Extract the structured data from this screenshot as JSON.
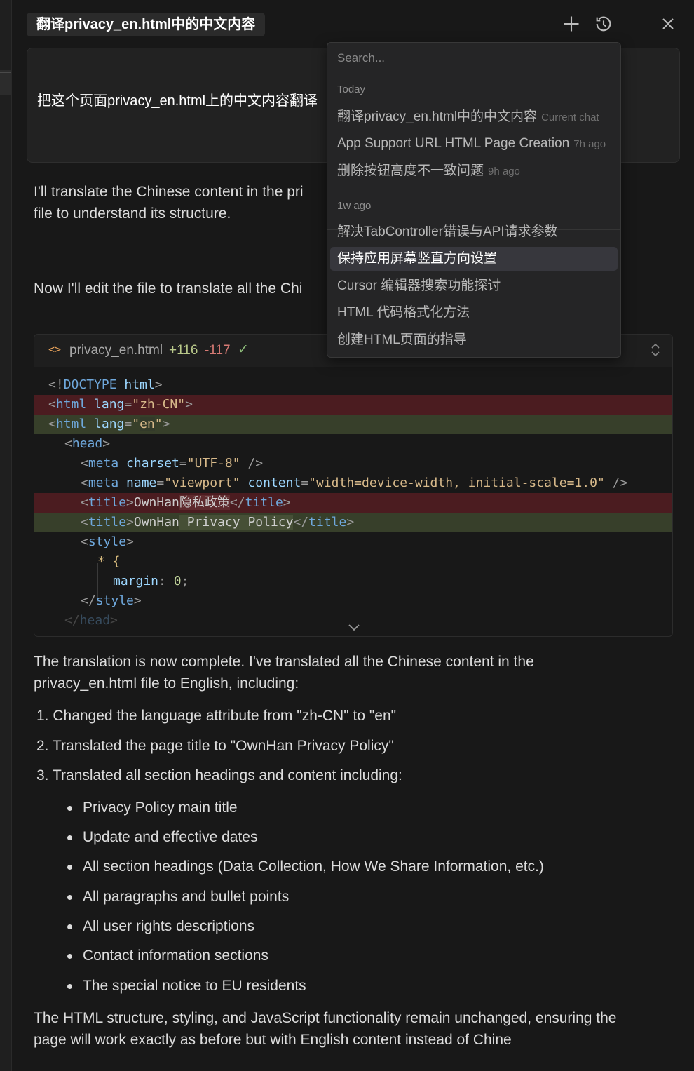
{
  "header": {
    "chat_title": "翻译privacy_en.html中的中文内容",
    "icons": [
      "plus-icon",
      "history-icon",
      "close-icon"
    ]
  },
  "user_message": "把这个页面privacy_en.html上的中文内容翻译",
  "assistant": {
    "intro_line1": "I'll translate the Chinese content in the pri",
    "intro_line2": "file to understand its structure.",
    "edit_line": "Now I'll edit the file to translate all the Chi",
    "summary_line1": "The translation is now complete. I've translated all the Chinese content in the",
    "summary_line2": "privacy_en.html file to English, including:",
    "numbered": [
      "1. Changed the language attribute from \"zh-CN\" to \"en\"",
      "2. Translated the page title to \"OwnHan Privacy Policy\"",
      "3. Translated all section headings and content including:"
    ],
    "bullets": [
      "Privacy Policy main title",
      "Update and effective dates",
      "All section headings (Data Collection, How We Share Information, etc.)",
      "All paragraphs and bullet points",
      "All user rights descriptions",
      "Contact information sections",
      "The special notice to EU residents"
    ],
    "closing_line1": "The HTML structure, styling, and JavaScript functionality remain unchanged, ensuring the",
    "closing_line2": "page will work exactly as before but with English content instead of Chine"
  },
  "code_block": {
    "file_icon": "<>",
    "filename": "privacy_en.html",
    "additions": "+116",
    "deletions": "-117",
    "check": "✓",
    "lines": {
      "l1_a": "<!",
      "l1_b": "DOCTYPE",
      "l1_c": " html",
      "l1_d": ">",
      "l2_a": "<",
      "l2_b": "html",
      "l2_c": " lang",
      "l2_d": "=",
      "l2_e": "\"zh-CN\"",
      "l2_f": ">",
      "l3_a": "<",
      "l3_b": "html",
      "l3_c": " lang",
      "l3_d": "=",
      "l3_e": "\"",
      "l3_f": "en",
      "l3_g": "\"",
      "l3_h": ">",
      "l4_a": "<",
      "l4_b": "head",
      "l4_c": ">",
      "l5_a": "<",
      "l5_b": "meta",
      "l5_c": " charset",
      "l5_d": "=",
      "l5_e": "\"UTF-8\"",
      "l5_f": " />",
      "l6_a": "<",
      "l6_b": "meta",
      "l6_c": " name",
      "l6_d": "=",
      "l6_e": "\"viewport\"",
      "l6_f": " content",
      "l6_g": "=",
      "l6_h": "\"width=device-width, initial-scale=1.0\"",
      "l6_i": " />",
      "l7_a": "<",
      "l7_b": "title",
      "l7_c": ">",
      "l7_d": "OwnHan",
      "l7_e": "隐私政策",
      "l7_f": "</",
      "l7_g": "title",
      "l7_h": ">",
      "l8_a": "<",
      "l8_b": "title",
      "l8_c": ">",
      "l8_d": "OwnHan",
      "l8_e": " Privacy Policy",
      "l8_f": "</",
      "l8_g": "title",
      "l8_h": ">",
      "l9_a": "<",
      "l9_b": "style",
      "l9_c": ">",
      "l10_a": "*",
      "l10_b": " {",
      "l11_a": "margin",
      "l11_b": ": ",
      "l11_c": "0",
      "l11_d": ";",
      "l12_a": "</",
      "l12_b": "style",
      "l12_c": ">",
      "l13_a": "</",
      "l13_b": "head",
      "l13_c": ">"
    }
  },
  "history_dropdown": {
    "search_placeholder": "Search...",
    "section_today": "Today",
    "section_week": "1w ago",
    "items_today": [
      {
        "label": "翻译privacy_en.html中的中文内容",
        "meta": "Current chat"
      },
      {
        "label": "App Support URL HTML Page Creation",
        "meta": "7h ago"
      },
      {
        "label": "删除按钮高度不一致问题",
        "meta": "9h ago"
      }
    ],
    "items_week": [
      {
        "label": "解决TabController错误与API请求参数"
      },
      {
        "label": "保持应用屏幕竖直方向设置"
      },
      {
        "label": "Cursor 编辑器搜索功能探讨"
      },
      {
        "label": "HTML 代码格式化方法"
      },
      {
        "label": "创建HTML页面的指导"
      }
    ]
  }
}
